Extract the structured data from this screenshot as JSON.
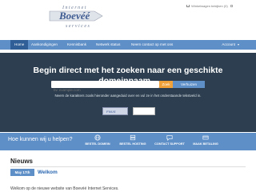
{
  "header": {
    "logo": {
      "line1": "Internet",
      "line2": "Boevéé",
      "line3": "services"
    },
    "cart_text": "Winkelwagen bekijken (0)"
  },
  "nav": {
    "items": [
      {
        "label": "Home",
        "active": true
      },
      {
        "label": "Aankondigingen"
      },
      {
        "label": "Kennisbank"
      },
      {
        "label": "Netwerk status"
      },
      {
        "label": "Neem contact op met ons"
      }
    ],
    "account_label": "Account"
  },
  "hero": {
    "title": "Begin direct met het zoeken naar een geschikte domeinnaam...",
    "search_placeholder": "bv. example.com",
    "zoek_label": "Zoek",
    "verhuizen_label": "Verhuizen",
    "instructions": "Neem de karakters zoals hieronder aangeduid over en vul ze in het onderstaande tekstveld in.",
    "captcha_text": "FNU5"
  },
  "helpbar": {
    "title": "Hoe kunnen wij u helpen?",
    "items": [
      {
        "label": "BESTEL DOMEIN",
        "icon": "globe-icon"
      },
      {
        "label": "BESTEL HOSTING",
        "icon": "hosting-icon"
      },
      {
        "label": "CONTACT SUPPORT",
        "icon": "support-icon"
      },
      {
        "label": "MAAK BETALING",
        "icon": "payment-icon"
      }
    ]
  },
  "news": {
    "title": "Nieuws",
    "items": [
      {
        "date": "May 17th",
        "heading": "Welkom",
        "text": "Welkom op de nieuwe website van Boevéé Internet Services."
      }
    ]
  },
  "colors": {
    "nav": "#5f8fc7",
    "hero": "#2c3e4f",
    "accent_orange": "#f0a13a"
  }
}
